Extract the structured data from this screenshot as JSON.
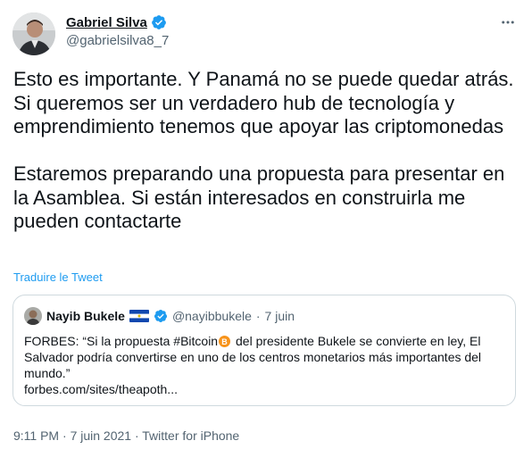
{
  "author": {
    "name": "Gabriel Silva",
    "handle": "@gabrielsilva8_7"
  },
  "tweet": {
    "paragraph1": "Esto es importante. Y Panamá no se puede quedar atrás. Si queremos ser un verdadero hub de tecnología y emprendimiento tenemos que apoyar las criptomonedas",
    "paragraph2": "Estaremos preparando una propuesta para presentar en la Asamblea. Si están interesados en construirla me pueden contactarte",
    "translate_label": "Traduire le Tweet"
  },
  "quoted_tweet": {
    "name": "Nayib Bukele",
    "handle": "@nayibbukele",
    "separator": "·",
    "date": "7 juin",
    "text_before_icon": "FORBES: “Si la propuesta #Bitcoin",
    "text_after_icon": " del presidente Bukele se convierte en ley, El Salvador podría convertirse en uno de los centros monetarios más importantes del mundo.”",
    "link": "forbes.com/sites/theapoth..."
  },
  "footer": {
    "time": "9:11 PM",
    "date": "7 juin 2021",
    "source": "Twitter for iPhone",
    "separator": "·"
  },
  "colors": {
    "accent": "#1d9bf0",
    "text": "#0f1419",
    "secondary": "#536471",
    "border": "#cfd9de",
    "bitcoin": "#f7931a"
  },
  "icons": [
    "verified-badge-icon",
    "more-options-icon",
    "el-salvador-flag-icon",
    "bitcoin-icon"
  ]
}
